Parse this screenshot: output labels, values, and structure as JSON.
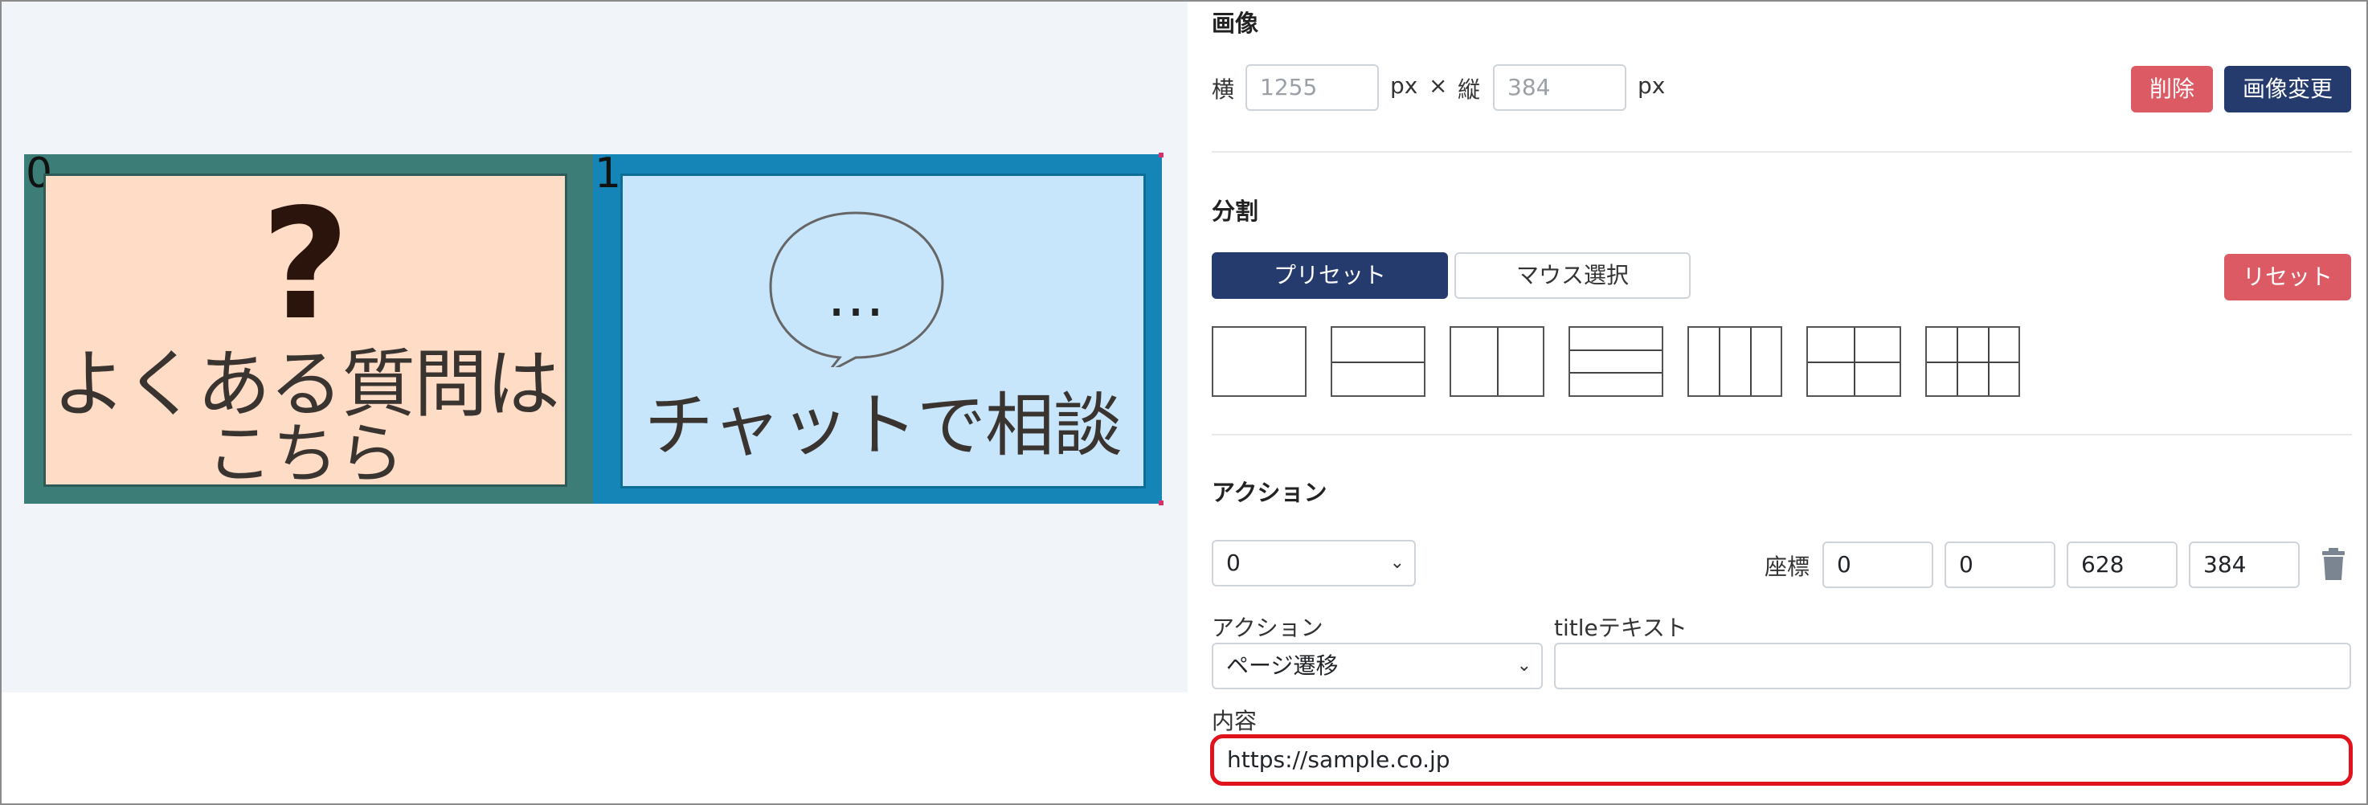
{
  "preview": {
    "areas": [
      {
        "index": "0",
        "line1": "よくある質問は",
        "line2": "こちら",
        "glyph": "?"
      },
      {
        "index": "1",
        "text": "チャットで相談",
        "glyph": "…"
      }
    ]
  },
  "image": {
    "title": "画像",
    "width_label": "横",
    "width_value": "1255",
    "unit": "px",
    "times": "×",
    "height_label": "縦",
    "height_value": "384",
    "delete_label": "削除",
    "change_label": "画像変更"
  },
  "split": {
    "title": "分割",
    "tab_preset": "プリセット",
    "tab_mouse": "マウス選択",
    "reset_label": "リセット",
    "presets": [
      "1x1",
      "2-rows",
      "2-cols",
      "3-rows",
      "3-cols",
      "2x2",
      "3x2"
    ]
  },
  "action": {
    "title": "アクション",
    "area_select": "0",
    "coords_label": "座標",
    "coords": [
      "0",
      "0",
      "628",
      "384"
    ],
    "type_label": "アクション",
    "type_value": "ページ遷移",
    "title_text_label": "titleテキスト",
    "title_text_value": "",
    "content_label": "内容",
    "content_value": "https://sample.co.jp"
  },
  "colors": {
    "primary": "#253b6e",
    "danger": "#dc5a64",
    "highlight": "#e0121b",
    "area0": "#3d7d78",
    "area1": "#1485b6"
  },
  "icons": [
    "chevron-down-icon",
    "trash-icon",
    "speech-bubble-icon",
    "question-mark-icon"
  ]
}
